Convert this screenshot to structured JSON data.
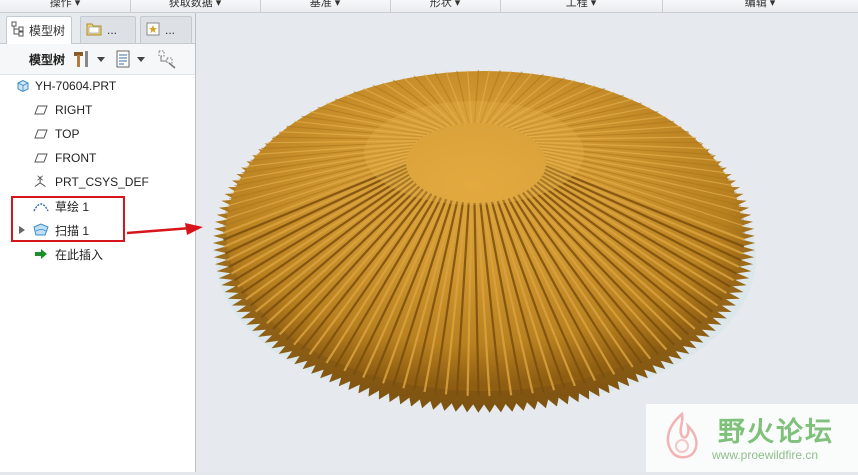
{
  "ribbon": {
    "groups": [
      "操作 ▾",
      "获取数据 ▾",
      "基准 ▾",
      "形状 ▾",
      "工程 ▾",
      "编辑 ▾"
    ]
  },
  "panel": {
    "tabs": {
      "model_tree": "模型树",
      "tab2": "...",
      "tab3": "..."
    },
    "toolbar": {
      "label": "模型树"
    },
    "tree": {
      "root": "YH-70604.PRT",
      "right": "RIGHT",
      "top": "TOP",
      "front": "FRONT",
      "csys": "PRT_CSYS_DEF",
      "sketch": "草绘 1",
      "sweep": "扫描 1",
      "insert": "在此插入"
    }
  },
  "watermark": {
    "title": "野火论坛",
    "url": "www.proewildfire.cn"
  },
  "colors": {
    "model_gold": "#c9922b",
    "annotation_red": "#d8141b",
    "insert_arrow_green": "#1a8f2a"
  }
}
